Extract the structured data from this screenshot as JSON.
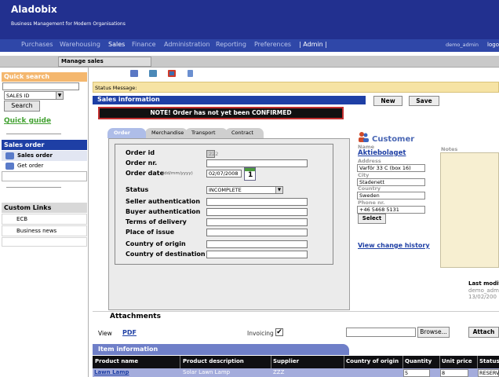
{
  "app": {
    "title": "Aladobix",
    "subtitle": "Business Management for Modern Organisations"
  },
  "nav": {
    "items": [
      "Purchases",
      "Warehousing",
      "Sales",
      "Finance",
      "Administration",
      "Reporting",
      "Preferences",
      "| Admin |"
    ],
    "active": "Sales",
    "user": "demo_admin",
    "logout": "logo"
  },
  "subbar": {
    "tab_label": "Manage sales"
  },
  "sidebar": {
    "quick_search_title": "Quick search",
    "quick_search_field": "SALES ID",
    "search_button": "Search",
    "quick_guide": "Quick guide",
    "sales_order_title": "Sales order",
    "sales_order_items": [
      "Sales order",
      "Get order"
    ],
    "custom_links_title": "Custom Links",
    "custom_links": [
      "ECB",
      "Business news"
    ]
  },
  "status": {
    "message_label": "Status Message:"
  },
  "sales": {
    "title": "Sales information",
    "new_button": "New",
    "save_button": "Save",
    "notice": "NOTE! Order has not yet been CONFIRMED"
  },
  "tabs": [
    "Order",
    "Merchandise",
    "Transport",
    "Contract"
  ],
  "form": {
    "order_id_label": "Order id",
    "order_id_value": "222",
    "order_nr_label": "Order nr.",
    "order_date_label": "Order date",
    "order_date_format": "(dd/mm/yyyy)",
    "order_date_value": "02/07/2008",
    "calendar_day": "1",
    "status_label": "Status",
    "status_value": "INCOMPLETE",
    "seller_auth_label": "Seller authentication",
    "buyer_auth_label": "Buyer authentication",
    "terms_label": "Terms of delivery",
    "place_label": "Place of issue",
    "country_origin_label": "Country of origin",
    "country_dest_label": "Country of destination"
  },
  "customer": {
    "title": "Customer",
    "name_label": "Name",
    "name_value": "Aktiebolaget",
    "address_label": "Address",
    "address_value": "Varför 33 C (box 16)",
    "city_label": "City",
    "city_value": "Stadenett",
    "country_label": "Country",
    "country_value": "Sweden",
    "phone_label": "Phone nr.",
    "phone_value": "+46 5468 5131",
    "select_button": "Select",
    "view_history": "View change history"
  },
  "notes": {
    "label": "Notes"
  },
  "last_modified": {
    "label": "Last modifi",
    "user": "demo_adm",
    "date": "13/02/200"
  },
  "attachments": {
    "title": "Attachments",
    "view_label": "View",
    "pdf_link": "PDF",
    "invoicing_label": "Invoicing",
    "invoicing_checked": "✔",
    "browse_button": "Browse...",
    "attach_button": "Attach"
  },
  "items": {
    "title": "Item information",
    "columns": [
      "Product name",
      "Product description",
      "Supplier",
      "Country of origin",
      "Quantity",
      "Unit price",
      "Status"
    ],
    "rows": [
      {
        "product": "Lawn Lamp",
        "description": "Solar Lawn Lamp",
        "supplier": "ZZZ",
        "country": "",
        "quantity": "5",
        "price": "8",
        "status": "RESERV"
      }
    ]
  }
}
